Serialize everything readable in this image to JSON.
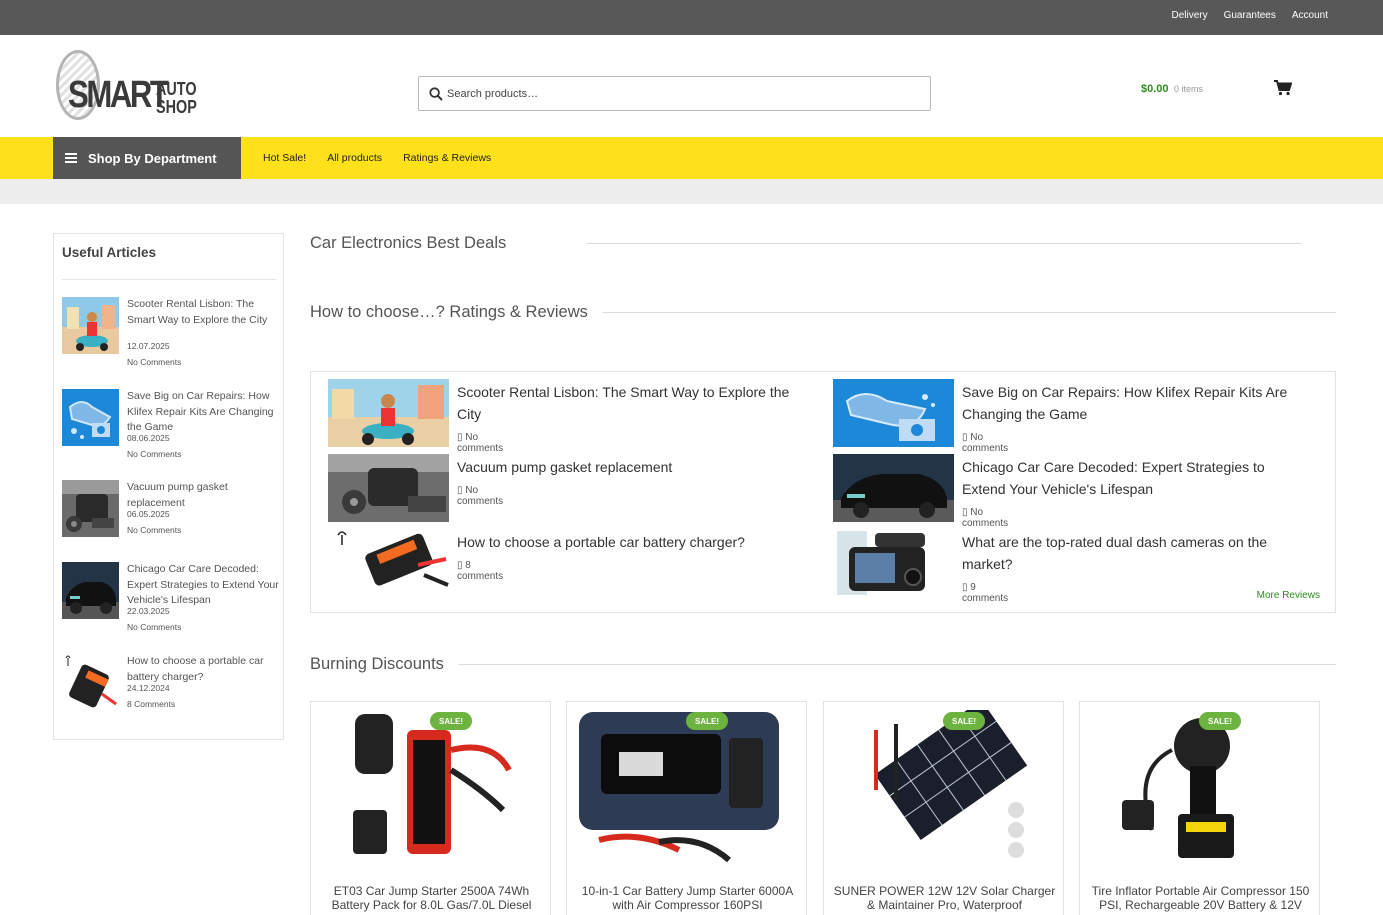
{
  "topbar": {
    "links": [
      "Delivery",
      "Guarantees",
      "Account"
    ]
  },
  "header": {
    "logo": {
      "smart": "SMART",
      "auto": "AUTO",
      "shop": "SHOP"
    },
    "search_placeholder": "Search products…",
    "cart_total": "$0.00",
    "cart_count": "0 items"
  },
  "nav": {
    "department_label": "Shop By Department",
    "links": [
      "Hot Sale!",
      "All products",
      "Ratings & Reviews"
    ]
  },
  "sidebar": {
    "title": "Useful Articles",
    "articles": [
      {
        "title": "Scooter Rental Lisbon: The Smart Way to Explore the City",
        "date": "12.07.2025",
        "comments": "No Comments"
      },
      {
        "title": "Save Big on Car Repairs: How Klifex Repair Kits Are Changing the Game",
        "date": "08.06.2025",
        "comments": "No Comments"
      },
      {
        "title": "Vacuum pump gasket replacement",
        "date": "06.05.2025",
        "comments": "No Comments"
      },
      {
        "title": "Chicago Car Care Decoded: Expert Strategies to Extend Your Vehicle's Lifespan",
        "date": "22.03.2025",
        "comments": "No Comments"
      },
      {
        "title": "How to choose a portable car battery charger?",
        "date": "24.12.2024",
        "comments": "8 Comments"
      }
    ]
  },
  "sections": {
    "electronics": "Car Electronics Best Deals",
    "reviews": "How to choose…? Ratings & Reviews",
    "discounts": "Burning Discounts"
  },
  "reviews": {
    "items": [
      {
        "title": "Scooter Rental Lisbon: The Smart Way to Explore the City",
        "comments": "No comments"
      },
      {
        "title": "Save Big on Car Repairs: How Klifex Repair Kits Are Changing the Game",
        "comments": "No comments"
      },
      {
        "title": "Vacuum pump gasket replacement",
        "comments": "No comments"
      },
      {
        "title": "Chicago Car Care Decoded: Expert Strategies to Extend Your Vehicle's Lifespan",
        "comments": "No comments"
      },
      {
        "title": "How to choose a portable car battery charger?",
        "comments": "8 comments"
      },
      {
        "title": "What are the top-rated dual dash cameras on the market?",
        "comments": "9 comments"
      }
    ],
    "more_label": "More Reviews"
  },
  "products": {
    "sale_badge": "SALE!",
    "items": [
      {
        "title": "ET03 Car Jump Starter 2500A 74Wh Battery Pack for 8.0L Gas/7.0L Diesel"
      },
      {
        "title": "10-in-1 Car Battery Jump Starter 6000A with Air Compressor 160PSI"
      },
      {
        "title": "SUNER POWER 12W 12V Solar Charger & Maintainer Pro, Waterproof"
      },
      {
        "title": "Tire Inflator Portable Air Compressor 150 PSI, Rechargeable 20V Battery & 12V"
      }
    ]
  },
  "colors": {
    "accent_yellow": "#fee01b",
    "topbar_grey": "#585858",
    "price_green": "#2e8b1f",
    "sale_green": "#6db33f"
  },
  "icons": [
    "search-icon",
    "cart-icon",
    "menu-icon",
    "comment-icon"
  ]
}
